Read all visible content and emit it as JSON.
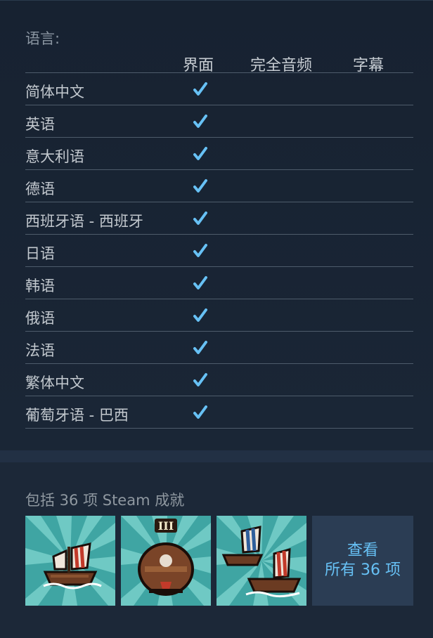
{
  "languages": {
    "title": "语言:",
    "columns": [
      "界面",
      "完全音频",
      "字幕"
    ],
    "rows": [
      {
        "name": "简体中文",
        "interface": true,
        "audio": false,
        "subtitles": false
      },
      {
        "name": "英语",
        "interface": true,
        "audio": false,
        "subtitles": false
      },
      {
        "name": "意大利语",
        "interface": true,
        "audio": false,
        "subtitles": false
      },
      {
        "name": "德语",
        "interface": true,
        "audio": false,
        "subtitles": false
      },
      {
        "name": "西班牙语 - 西班牙",
        "interface": true,
        "audio": false,
        "subtitles": false
      },
      {
        "name": "日语",
        "interface": true,
        "audio": false,
        "subtitles": false
      },
      {
        "name": "韩语",
        "interface": true,
        "audio": false,
        "subtitles": false
      },
      {
        "name": "俄语",
        "interface": true,
        "audio": false,
        "subtitles": false
      },
      {
        "name": "法语",
        "interface": true,
        "audio": false,
        "subtitles": false
      },
      {
        "name": "繁体中文",
        "interface": true,
        "audio": false,
        "subtitles": false
      },
      {
        "name": "葡萄牙语 - 巴西",
        "interface": true,
        "audio": false,
        "subtitles": false
      }
    ],
    "check_icon": "checkmark-icon",
    "check_color": "#67c1f5"
  },
  "achievements": {
    "title": "包括 36 项 Steam 成就",
    "icons": [
      {
        "icon": "ship-icon"
      },
      {
        "icon": "treasure-chest-icon",
        "badge": "III"
      },
      {
        "icon": "fleet-icon"
      }
    ],
    "view_all_line1": "查看",
    "view_all_line2": "所有 36 项",
    "accent": "#67c1f5"
  }
}
